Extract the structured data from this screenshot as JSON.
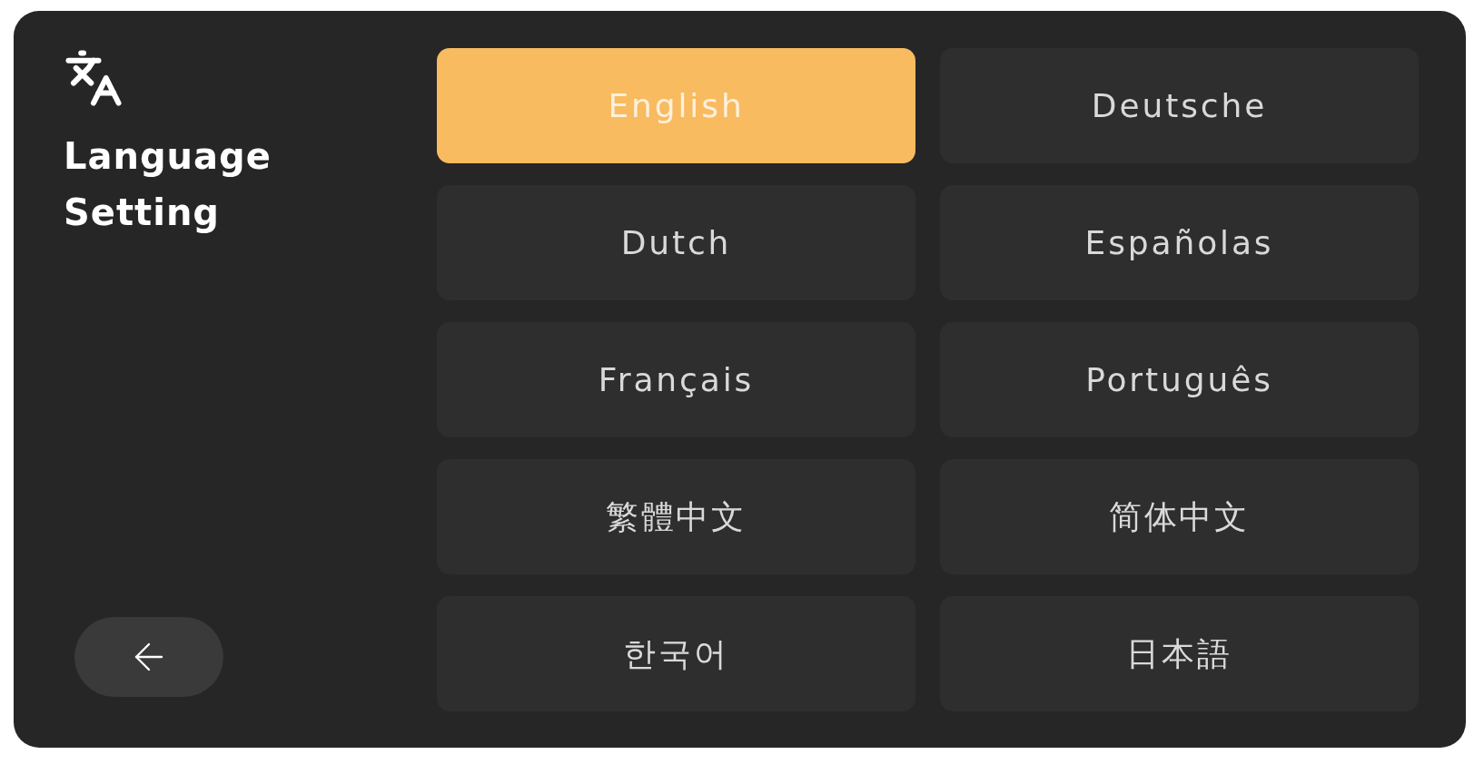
{
  "sidebar": {
    "title": "Language Setting"
  },
  "languages": [
    {
      "label": "English",
      "selected": true
    },
    {
      "label": "Deutsche",
      "selected": false
    },
    {
      "label": "Dutch",
      "selected": false
    },
    {
      "label": "Españolas",
      "selected": false
    },
    {
      "label": "Français",
      "selected": false
    },
    {
      "label": "Português",
      "selected": false
    },
    {
      "label": "繁體中文",
      "selected": false
    },
    {
      "label": "简体中文",
      "selected": false
    },
    {
      "label": "한국어",
      "selected": false
    },
    {
      "label": "日本語",
      "selected": false
    }
  ]
}
